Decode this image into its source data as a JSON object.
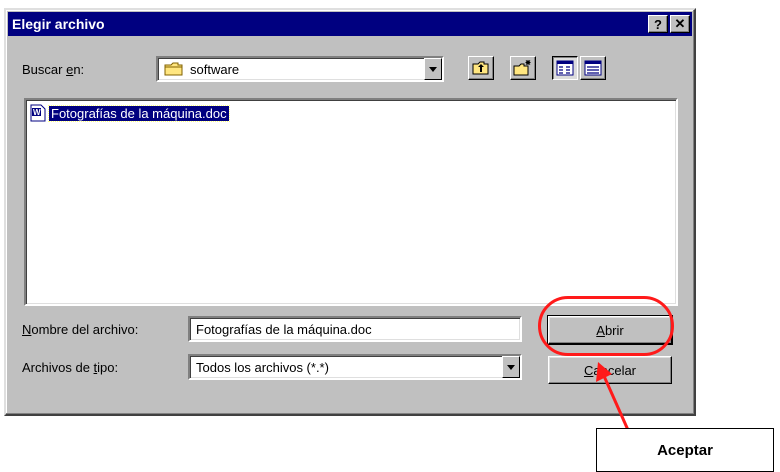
{
  "dialog": {
    "title": "Elegir archivo",
    "help_glyph": "?",
    "close_glyph": "✕"
  },
  "lookin": {
    "label_pre": "Buscar ",
    "label_access": "e",
    "label_post": "n:",
    "value": "software",
    "folder_icon": "folder-icon"
  },
  "toolbar": {
    "buttons": [
      "up-one-level-icon",
      "new-folder-icon",
      "list-view-icon",
      "details-view-icon"
    ]
  },
  "filelist": {
    "items": [
      {
        "name": "Fotografías de la máquina.doc",
        "icon": "word-document-icon"
      }
    ]
  },
  "filename": {
    "label_access": "N",
    "label_rest": "ombre del archivo:",
    "value": "Fotografías de la máquina.doc"
  },
  "filetype": {
    "label_pre": "Archivos de ",
    "label_access": "t",
    "label_post": "ipo:",
    "value": "Todos los archivos (*.*)"
  },
  "buttons": {
    "open_access": "A",
    "open_rest": "brir",
    "cancel_access": "C",
    "cancel_rest": "ancelar"
  },
  "annotation": {
    "callout_text": "Aceptar",
    "highlight_color": "#ff1a1a"
  }
}
